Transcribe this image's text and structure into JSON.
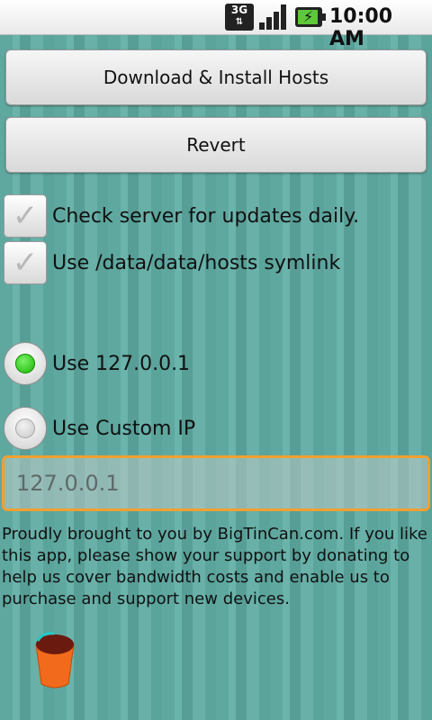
{
  "status_bar": {
    "network_label": "3G",
    "network_arrows": "⇅",
    "time": "10:00 AM",
    "icons": [
      "network-3g-icon",
      "signal-icon",
      "battery-charging-icon"
    ],
    "battery_color": "#5cc83a"
  },
  "actions": {
    "download_label": "Download & Install Hosts",
    "revert_label": "Revert"
  },
  "options": {
    "check_updates_label": "Check server for updates daily.",
    "symlink_label": "Use /data/data/hosts symlink",
    "check_mark": "✓"
  },
  "ip_choice": {
    "localhost_label": "Use 127.0.0.1",
    "custom_label": "Use Custom IP",
    "selected": "localhost",
    "custom_ip_placeholder": "127.0.0.1"
  },
  "footer": {
    "blurb": "Proudly brought to you by BigTinCan.com. If you like this app, please show your support by donating to help us cover bandwidth costs and enable us to purchase and support new devices.",
    "donate_icon": "tin-can-icon"
  },
  "colors": {
    "accent_focus": "#f0a030",
    "radio_selected": "#17b800",
    "background": "#5fa8a0"
  }
}
